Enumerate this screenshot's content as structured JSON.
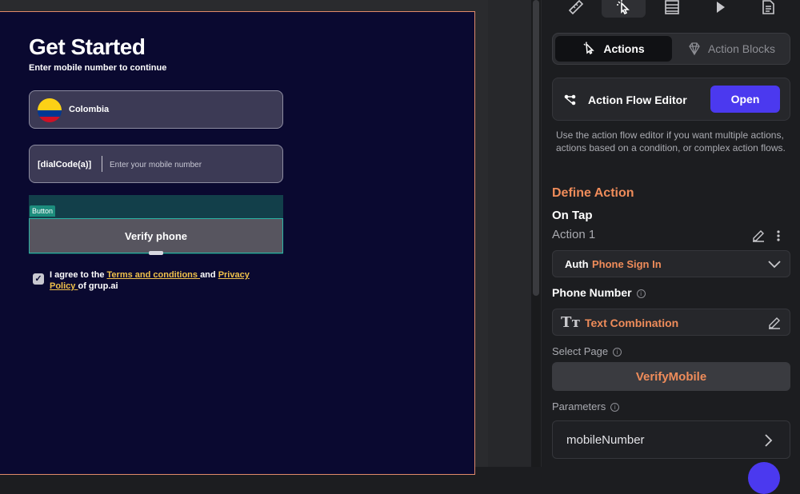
{
  "canvas": {
    "title": "Get Started",
    "subtitle": "Enter mobile number to continue",
    "country_label": "Colombia",
    "dial_code": "[dialCode(a)]",
    "mobile_placeholder": "Enter your mobile number",
    "button_tag": "Button",
    "verify_label": "Verify phone",
    "agree_prefix": "I agree to the ",
    "terms_link": "Terms and conditions ",
    "agree_and": "and ",
    "privacy_link": "Privacy Policy ",
    "agree_suffix": "of grup.ai"
  },
  "panel": {
    "top_tabs": [
      "ruler-icon",
      "pointer-click-icon",
      "table-icon",
      "play-icon",
      "document-icon"
    ],
    "tab_actions": "Actions",
    "tab_action_blocks": "Action Blocks",
    "flow_editor_title": "Action Flow Editor",
    "open_label": "Open",
    "help_text": "Use the action flow editor if you want multiple actions, actions based on a condition, or complex action flows.",
    "define_action": "Define Action",
    "on_tap": "On Tap",
    "action1": "Action 1",
    "action_category": "Auth",
    "action_type": "Phone Sign In",
    "phone_number_label": "Phone Number",
    "text_combination": "Text Combination",
    "select_page_label": "Select Page",
    "page_value": "VerifyMobile",
    "parameters_label": "Parameters",
    "param_name": "mobileNumber"
  },
  "colors": {
    "accent": "#4b39ef",
    "orange": "#ef8c5a",
    "canvas_bg": "#0a0930",
    "link": "#f0c14b"
  }
}
